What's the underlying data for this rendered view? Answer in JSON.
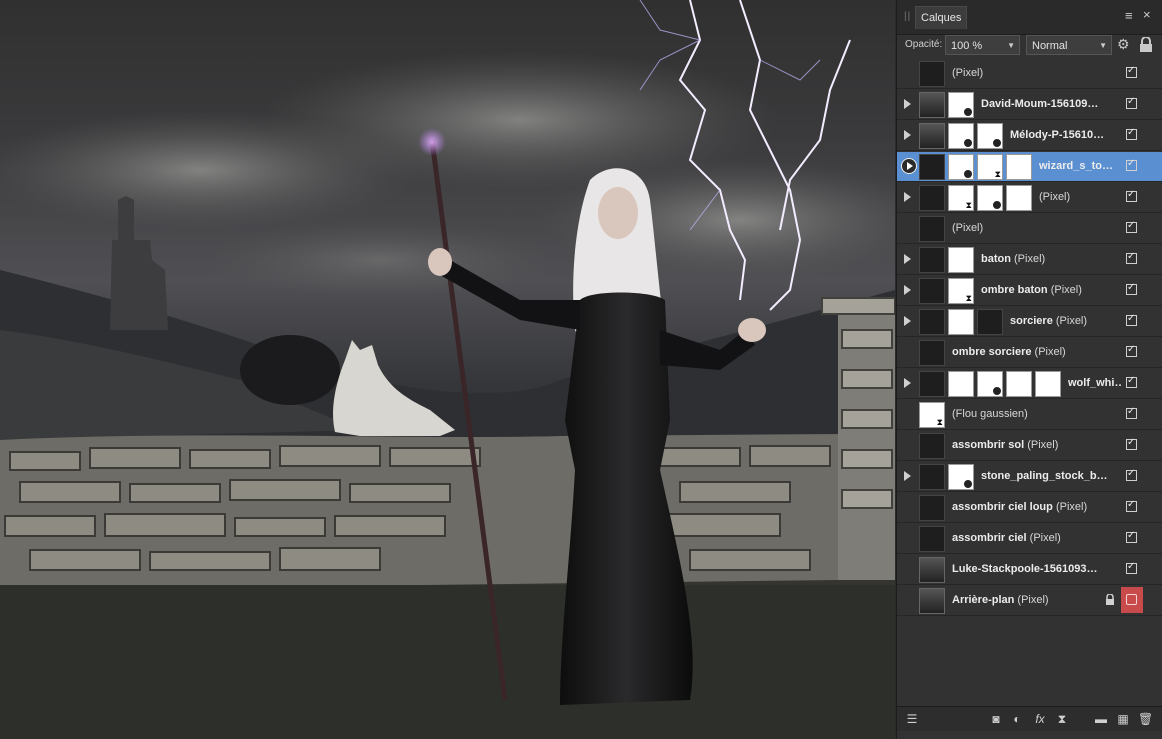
{
  "panel": {
    "tab_title": "Calques",
    "opacity_label": "Opacité:",
    "opacity_value": "100 %",
    "blend_mode": "Normal",
    "icons": {
      "menu": "menu-icon",
      "close": "close-icon",
      "settings": "gear-icon",
      "lock": "lock-icon"
    }
  },
  "layers": [
    {
      "name": "",
      "sub": "(Pixel)",
      "expand": false,
      "thumbs": [
        "dark"
      ],
      "visible": true
    },
    {
      "name": "David-Moum-156109…",
      "sub": "",
      "expand": true,
      "thumbs": [
        "photo",
        "white-badge"
      ],
      "visible": true
    },
    {
      "name": "Mélody-P-15610…",
      "sub": "",
      "expand": true,
      "thumbs": [
        "photo",
        "white-badge",
        "white-badge"
      ],
      "visible": true
    },
    {
      "name": "wizard_s_to…",
      "sub": "",
      "expand": true,
      "selected": true,
      "thumbs": [
        "dark",
        "white-badge",
        "white-hg",
        "white"
      ],
      "visible": true
    },
    {
      "name": "",
      "sub": "(Pixel)",
      "expand": true,
      "thumbs": [
        "dark",
        "white-hg",
        "white-badge",
        "white"
      ],
      "visible": true
    },
    {
      "name": "",
      "sub": "(Pixel)",
      "expand": false,
      "thumbs": [
        "dark"
      ],
      "visible": true
    },
    {
      "name": "baton",
      "sub": "(Pixel)",
      "expand": true,
      "thumbs": [
        "dark",
        "white"
      ],
      "visible": true
    },
    {
      "name": "ombre baton",
      "sub": "(Pixel)",
      "expand": true,
      "thumbs": [
        "dark",
        "white-hg"
      ],
      "visible": true
    },
    {
      "name": "sorciere",
      "sub": "(Pixel)",
      "expand": true,
      "thumbs": [
        "dark",
        "white",
        "dark"
      ],
      "visible": true
    },
    {
      "name": "ombre sorciere",
      "sub": "(Pixel)",
      "expand": false,
      "thumbs": [
        "dark"
      ],
      "visible": true
    },
    {
      "name": "wolf_whi…",
      "sub": "",
      "expand": true,
      "thumbs": [
        "dark",
        "white",
        "white-badge",
        "white",
        "white"
      ],
      "visible": true
    },
    {
      "name": "",
      "sub": "(Flou gaussien)",
      "expand": false,
      "thumbs": [
        "white-hg"
      ],
      "visible": true
    },
    {
      "name": "assombrir sol",
      "sub": "(Pixel)",
      "expand": false,
      "thumbs": [
        "dark"
      ],
      "visible": true
    },
    {
      "name": "stone_paling_stock_b…",
      "sub": "",
      "expand": true,
      "thumbs": [
        "dark",
        "white-badge"
      ],
      "visible": true
    },
    {
      "name": "assombrir ciel loup",
      "sub": "(Pixel)",
      "expand": false,
      "thumbs": [
        "dark"
      ],
      "visible": true
    },
    {
      "name": "assombrir ciel",
      "sub": "(Pixel)",
      "expand": false,
      "thumbs": [
        "dark"
      ],
      "visible": true
    },
    {
      "name": "Luke-Stackpoole-1561093…",
      "sub": "",
      "expand": false,
      "thumbs": [
        "photo"
      ],
      "visible": true
    },
    {
      "name": "Arrière-plan",
      "sub": "(Pixel)",
      "expand": false,
      "thumbs": [
        "photo"
      ],
      "locked": true,
      "visible": false
    }
  ],
  "footer_icons": [
    "layers-icon",
    "mask-icon",
    "adjustment-icon",
    "fx-icon",
    "hourglass-icon",
    "folder-icon",
    "checker-icon",
    "trash-icon"
  ],
  "colors": {
    "selection": "#5a8fd1",
    "panel_bg": "#323232",
    "lock_red": "#c94a4a"
  }
}
